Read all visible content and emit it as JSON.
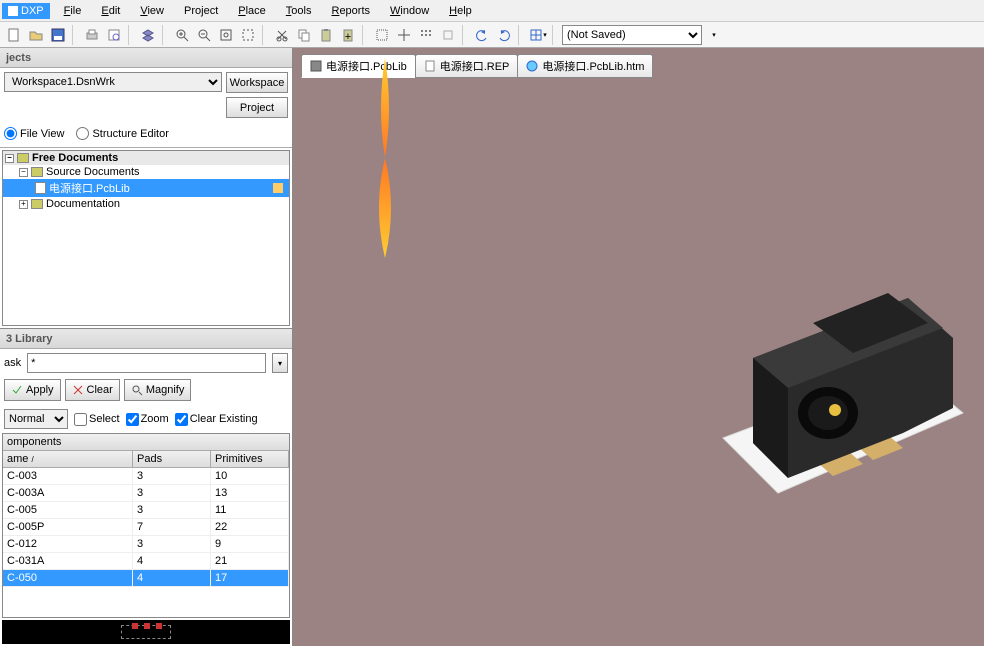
{
  "app": {
    "dxp_label": "DXP"
  },
  "menu": {
    "file": "File",
    "edit": "Edit",
    "view": "View",
    "project": "Project",
    "place": "Place",
    "tools": "Tools",
    "reports": "Reports",
    "window": "Window",
    "help": "Help"
  },
  "toolbar": {
    "saved_state": "(Not Saved)"
  },
  "projects": {
    "title": "jects",
    "workspace": "Workspace1.DsnWrk",
    "workspace_btn": "Workspace",
    "project_btn": "Project",
    "file_view": "File View",
    "structure_editor": "Structure Editor",
    "tree": {
      "root": "Free Documents",
      "source": "Source Documents",
      "file": "电源接口.PcbLib",
      "documentation": "Documentation"
    }
  },
  "library": {
    "title": "3 Library",
    "mask_label": "ask",
    "mask_value": "*",
    "apply": "Apply",
    "clear": "Clear",
    "magnify": "Magnify",
    "normal": "Normal",
    "select": "Select",
    "zoom": "Zoom",
    "clear_existing": "Clear Existing",
    "components_header": "omponents",
    "col_name": "ame",
    "col_pads": "Pads",
    "col_primitives": "Primitives",
    "rows": [
      {
        "name": "C-003",
        "pads": "3",
        "prim": "10"
      },
      {
        "name": "C-003A",
        "pads": "3",
        "prim": "13"
      },
      {
        "name": "C-005",
        "pads": "3",
        "prim": "11"
      },
      {
        "name": "C-005P",
        "pads": "7",
        "prim": "22"
      },
      {
        "name": "C-012",
        "pads": "3",
        "prim": "9"
      },
      {
        "name": "C-031A",
        "pads": "4",
        "prim": "21"
      },
      {
        "name": "C-050",
        "pads": "4",
        "prim": "17"
      }
    ]
  },
  "doc_tabs": {
    "t1": "电源接口.PcbLib",
    "t2": "电源接口.REP",
    "t3": "电源接口.PcbLib.htm"
  }
}
